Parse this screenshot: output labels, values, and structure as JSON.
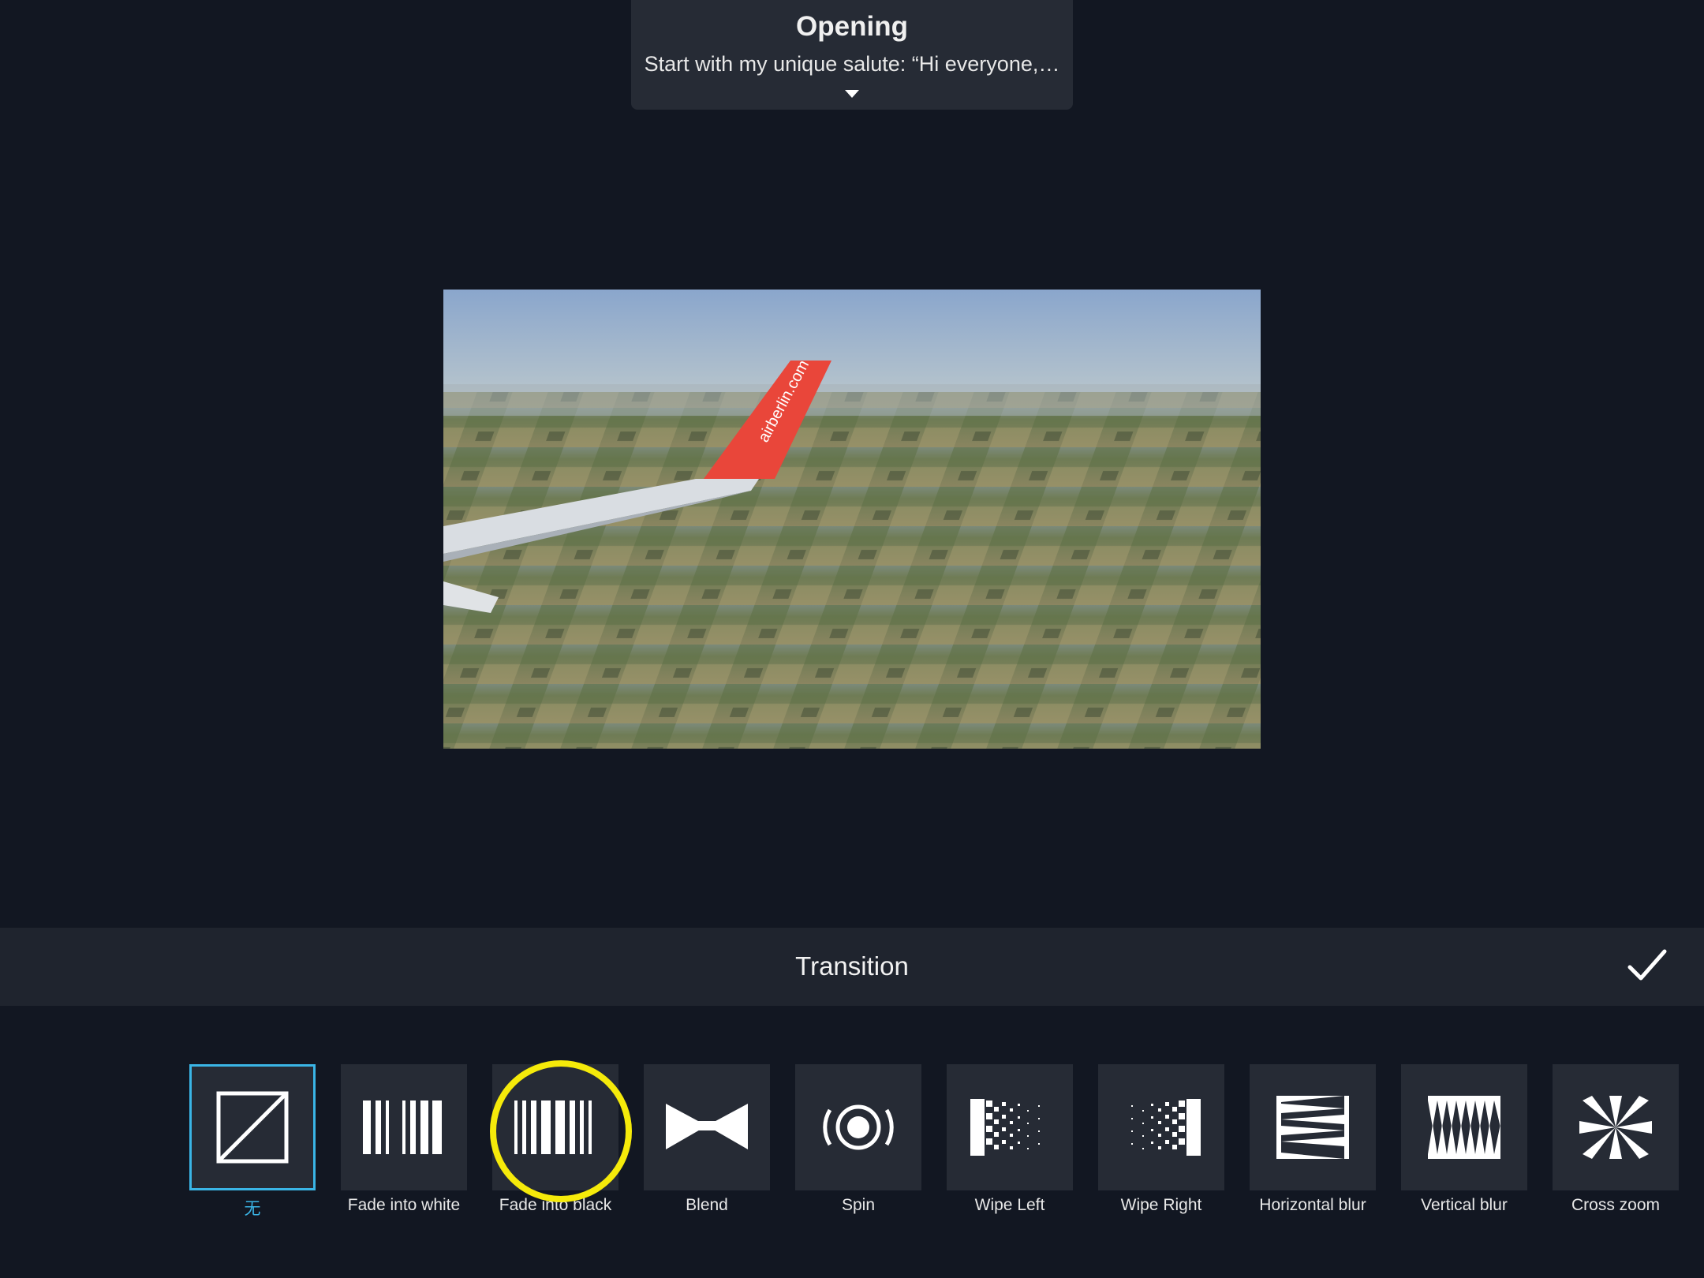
{
  "opening": {
    "title": "Opening",
    "subtitle": "Start with my unique salute: “Hi everyone,…"
  },
  "preview": {
    "wing_text": "airberlin.com"
  },
  "bar": {
    "title": "Transition",
    "confirm_icon": "checkmark-icon"
  },
  "transitions": [
    {
      "label": "无",
      "icon": "none-transition-icon",
      "selected": true
    },
    {
      "label": "Fade into white",
      "icon": "fade-white-icon",
      "selected": false
    },
    {
      "label": "Fade into black",
      "icon": "fade-black-icon",
      "selected": false
    },
    {
      "label": "Blend",
      "icon": "blend-icon",
      "selected": false
    },
    {
      "label": "Spin",
      "icon": "spin-icon",
      "selected": false
    },
    {
      "label": "Wipe Left",
      "icon": "wipe-left-icon",
      "selected": false
    },
    {
      "label": "Wipe Right",
      "icon": "wipe-right-icon",
      "selected": false
    },
    {
      "label": "Horizontal blur",
      "icon": "horizontal-blur-icon",
      "selected": false
    },
    {
      "label": "Vertical blur",
      "icon": "vertical-blur-icon",
      "selected": false
    },
    {
      "label": "Cross zoom",
      "icon": "cross-zoom-icon",
      "selected": false
    }
  ],
  "colors": {
    "background": "#121722",
    "panel": "#262b35",
    "selected_accent": "#3ab5e6",
    "highlight_ring": "#f5ea0a"
  }
}
